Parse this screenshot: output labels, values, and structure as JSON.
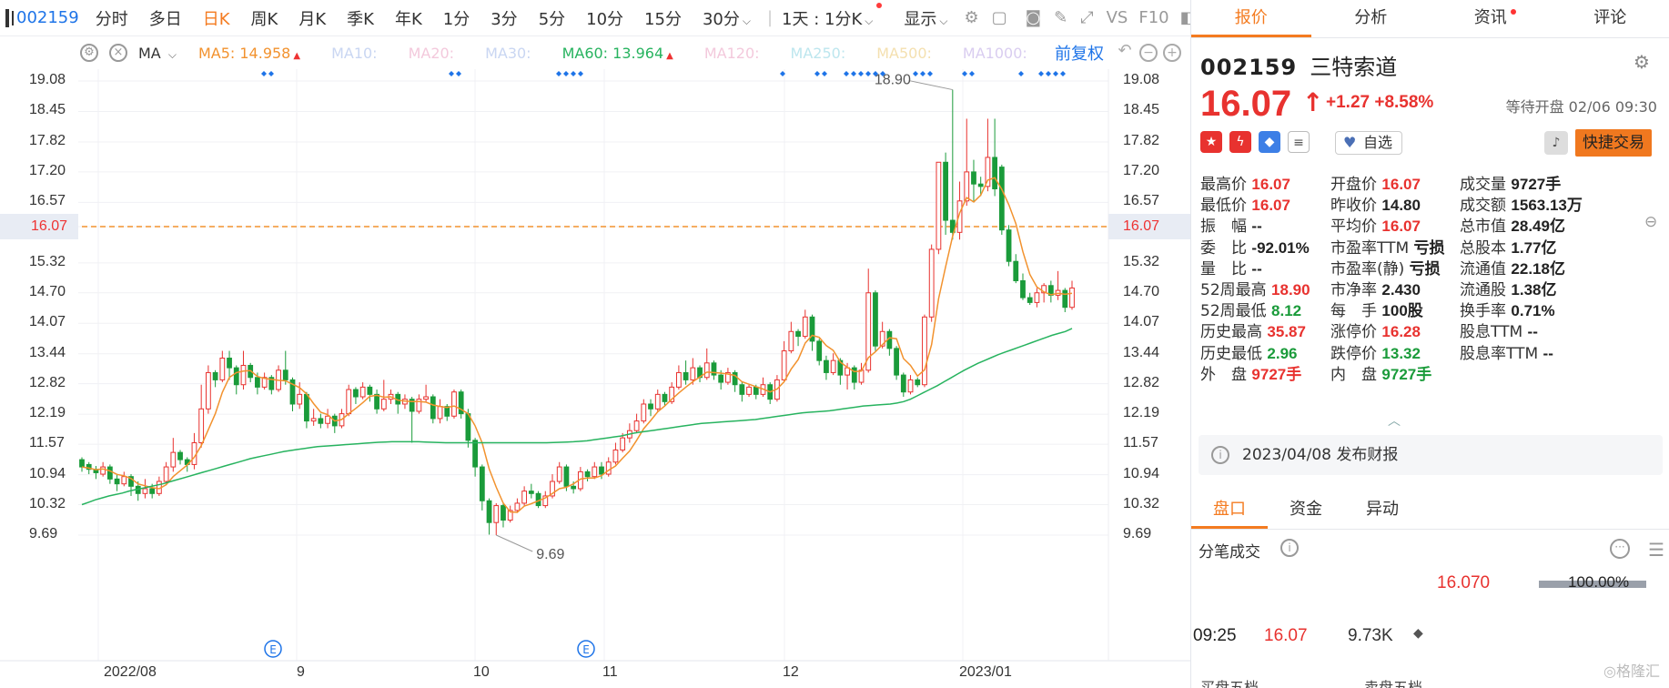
{
  "toolbar": {
    "code": "002159",
    "items": [
      "分时",
      "多日",
      "日K",
      "周K",
      "月K",
      "季K",
      "年K",
      "1分",
      "3分",
      "5分",
      "10分",
      "15分"
    ],
    "active": "日K",
    "dropdown_30": "30分",
    "dropdown_range": "1天 : 1分K",
    "dropdown_display": "显示",
    "vs": "VS",
    "f10": "F10"
  },
  "ma_bar": {
    "selector": "MA",
    "ma5_label": "MA5:",
    "ma5_value": "14.958",
    "ma10": "MA10:",
    "ma20": "MA20:",
    "ma30": "MA30:",
    "ma60_label": "MA60:",
    "ma60_value": "13.964",
    "ma120": "MA120:",
    "ma250": "MA250:",
    "ma500": "MA500:",
    "ma1000": "MA1000:",
    "adjust": "前复权",
    "colors": {
      "ma5": "#f2922e",
      "ma60": "#27b35f",
      "faint": "#c9d6f2"
    }
  },
  "chart_data": {
    "type": "candlestick",
    "y_ticks": [
      "19.08",
      "18.45",
      "17.82",
      "17.20",
      "16.57",
      "16.07",
      "15.32",
      "14.70",
      "14.07",
      "13.44",
      "12.82",
      "12.19",
      "11.57",
      "10.94",
      "10.32",
      "9.69"
    ],
    "current_price": "16.07",
    "x_labels": [
      "2022/08",
      "9",
      "10",
      "11",
      "12",
      "2023/01"
    ],
    "annotation_high": "18.90",
    "annotation_low": "9.69",
    "event_marker": "E",
    "candles": [
      [
        11.25,
        11.1,
        11.3,
        11.0
      ],
      [
        11.15,
        11.05,
        11.2,
        10.95
      ],
      [
        11.05,
        10.98,
        11.12,
        10.85
      ],
      [
        10.95,
        11.1,
        11.2,
        10.9
      ],
      [
        11.1,
        10.85,
        11.15,
        10.75
      ],
      [
        10.85,
        10.75,
        10.95,
        10.6
      ],
      [
        10.75,
        10.9,
        11.0,
        10.7
      ],
      [
        10.9,
        10.7,
        10.95,
        10.5
      ],
      [
        10.7,
        10.55,
        10.8,
        10.4
      ],
      [
        10.55,
        10.65,
        10.85,
        10.45
      ],
      [
        10.65,
        10.55,
        10.75,
        10.45
      ],
      [
        10.55,
        10.8,
        10.9,
        10.5
      ],
      [
        10.8,
        11.1,
        11.2,
        10.75
      ],
      [
        11.1,
        11.4,
        11.7,
        11.0
      ],
      [
        11.4,
        11.25,
        11.45,
        11.15
      ],
      [
        11.25,
        11.15,
        11.3,
        11.0
      ],
      [
        11.15,
        11.6,
        11.8,
        11.05
      ],
      [
        11.6,
        12.3,
        12.8,
        11.5
      ],
      [
        12.3,
        13.05,
        13.2,
        12.2
      ],
      [
        13.05,
        12.9,
        13.1,
        12.75
      ],
      [
        12.9,
        13.35,
        13.5,
        12.85
      ],
      [
        13.35,
        13.15,
        13.5,
        12.9
      ],
      [
        13.15,
        12.8,
        13.2,
        12.6
      ],
      [
        12.8,
        13.2,
        13.5,
        12.7
      ],
      [
        13.2,
        12.95,
        13.25,
        12.85
      ],
      [
        12.95,
        12.75,
        13.05,
        12.6
      ],
      [
        12.75,
        12.95,
        13.05,
        12.7
      ],
      [
        12.95,
        12.7,
        13.0,
        12.6
      ],
      [
        12.7,
        13.1,
        13.2,
        12.65
      ],
      [
        13.1,
        12.9,
        13.5,
        12.8
      ],
      [
        12.9,
        12.4,
        12.95,
        12.25
      ],
      [
        12.4,
        12.6,
        12.85,
        12.3
      ],
      [
        12.6,
        12.05,
        12.65,
        11.9
      ],
      [
        12.05,
        12.1,
        12.3,
        11.95
      ],
      [
        12.1,
        12.0,
        12.2,
        11.9
      ],
      [
        12.0,
        12.15,
        12.3,
        11.9
      ],
      [
        12.15,
        11.95,
        12.2,
        11.8
      ],
      [
        11.95,
        12.2,
        12.3,
        11.9
      ],
      [
        12.2,
        12.7,
        12.8,
        12.15
      ],
      [
        12.7,
        12.55,
        12.75,
        12.4
      ],
      [
        12.55,
        12.75,
        12.85,
        12.5
      ],
      [
        12.75,
        12.6,
        12.8,
        12.45
      ],
      [
        12.6,
        12.3,
        12.7,
        12.2
      ],
      [
        12.3,
        12.5,
        12.9,
        12.25
      ],
      [
        12.5,
        12.6,
        12.7,
        12.4
      ],
      [
        12.6,
        12.4,
        12.65,
        12.2
      ],
      [
        12.4,
        12.5,
        12.6,
        12.3
      ],
      [
        12.5,
        12.25,
        12.55,
        11.6
      ],
      [
        12.25,
        12.5,
        12.6,
        12.2
      ],
      [
        12.5,
        12.55,
        12.8,
        12.45
      ],
      [
        12.55,
        12.1,
        12.6,
        12.0
      ],
      [
        12.1,
        12.35,
        12.5,
        12.0
      ],
      [
        12.35,
        12.15,
        12.4,
        12.05
      ],
      [
        12.15,
        12.65,
        12.7,
        12.1
      ],
      [
        12.65,
        12.2,
        12.7,
        12.1
      ],
      [
        12.2,
        11.65,
        12.3,
        11.5
      ],
      [
        11.65,
        11.1,
        11.7,
        10.9
      ],
      [
        11.1,
        10.4,
        11.15,
        10.2
      ],
      [
        10.4,
        9.95,
        10.45,
        9.7
      ],
      [
        9.95,
        10.3,
        10.35,
        9.69
      ],
      [
        10.3,
        10.0,
        10.35,
        9.85
      ],
      [
        10.0,
        10.2,
        10.3,
        9.95
      ],
      [
        10.2,
        10.35,
        10.45,
        10.15
      ],
      [
        10.35,
        10.6,
        10.7,
        10.3
      ],
      [
        10.6,
        10.55,
        10.75,
        10.45
      ],
      [
        10.55,
        10.3,
        10.6,
        10.25
      ],
      [
        10.3,
        10.5,
        10.6,
        10.25
      ],
      [
        10.5,
        10.8,
        10.95,
        10.45
      ],
      [
        10.8,
        11.1,
        11.2,
        10.75
      ],
      [
        11.1,
        10.7,
        11.15,
        10.6
      ],
      [
        10.7,
        10.65,
        10.8,
        10.55
      ],
      [
        10.65,
        11.0,
        11.1,
        10.6
      ],
      [
        11.0,
        10.9,
        11.05,
        10.8
      ],
      [
        10.9,
        11.1,
        11.2,
        10.85
      ],
      [
        11.1,
        10.95,
        11.2,
        10.85
      ],
      [
        10.95,
        11.2,
        11.3,
        10.9
      ],
      [
        11.2,
        11.45,
        11.6,
        11.15
      ],
      [
        11.45,
        11.7,
        11.8,
        11.4
      ],
      [
        11.7,
        11.85,
        12.0,
        11.6
      ],
      [
        11.85,
        12.05,
        12.2,
        11.8
      ],
      [
        12.05,
        12.4,
        12.5,
        12.0
      ],
      [
        12.4,
        12.3,
        12.5,
        12.15
      ],
      [
        12.3,
        12.6,
        12.7,
        12.25
      ],
      [
        12.6,
        12.45,
        12.65,
        12.35
      ],
      [
        12.45,
        12.75,
        12.85,
        12.4
      ],
      [
        12.75,
        13.05,
        13.2,
        12.7
      ],
      [
        13.05,
        12.9,
        13.3,
        12.8
      ],
      [
        12.9,
        13.15,
        13.35,
        12.8
      ],
      [
        13.15,
        12.95,
        13.2,
        12.85
      ],
      [
        12.95,
        13.25,
        13.55,
        12.9
      ],
      [
        13.25,
        13.0,
        13.3,
        12.9
      ],
      [
        13.0,
        12.85,
        13.1,
        12.7
      ],
      [
        12.85,
        13.05,
        13.15,
        12.8
      ],
      [
        13.05,
        12.8,
        13.1,
        12.65
      ],
      [
        12.8,
        12.6,
        12.85,
        12.45
      ],
      [
        12.6,
        12.75,
        12.8,
        12.55
      ],
      [
        12.75,
        12.6,
        12.8,
        12.5
      ],
      [
        12.6,
        12.8,
        12.95,
        12.55
      ],
      [
        12.8,
        12.5,
        12.85,
        12.4
      ],
      [
        12.5,
        12.9,
        13.0,
        12.45
      ],
      [
        12.9,
        13.5,
        13.7,
        12.85
      ],
      [
        13.5,
        13.9,
        14.1,
        13.45
      ],
      [
        13.9,
        13.8,
        13.95,
        13.6
      ],
      [
        13.8,
        14.2,
        14.35,
        13.75
      ],
      [
        14.2,
        13.7,
        14.25,
        13.5
      ],
      [
        13.7,
        13.3,
        13.75,
        13.2
      ],
      [
        13.3,
        13.05,
        13.4,
        12.9
      ],
      [
        13.05,
        13.3,
        13.45,
        13.0
      ],
      [
        13.3,
        13.0,
        13.35,
        12.8
      ],
      [
        13.0,
        13.15,
        13.25,
        12.7
      ],
      [
        13.15,
        12.85,
        13.2,
        12.7
      ],
      [
        12.85,
        13.1,
        13.25,
        12.8
      ],
      [
        13.1,
        14.7,
        15.2,
        13.05
      ],
      [
        14.7,
        13.6,
        14.75,
        13.5
      ],
      [
        13.6,
        13.9,
        14.1,
        13.55
      ],
      [
        13.9,
        13.55,
        13.95,
        13.4
      ],
      [
        13.55,
        13.0,
        13.6,
        12.9
      ],
      [
        13.0,
        12.65,
        13.05,
        12.55
      ],
      [
        12.65,
        12.9,
        13.0,
        12.6
      ],
      [
        12.9,
        12.8,
        12.95,
        12.75
      ],
      [
        12.8,
        14.2,
        14.25,
        12.75
      ],
      [
        14.2,
        15.6,
        15.7,
        14.1
      ],
      [
        15.6,
        17.4,
        17.4,
        15.5
      ],
      [
        17.4,
        16.2,
        17.6,
        15.9
      ],
      [
        16.2,
        15.95,
        18.9,
        15.8
      ],
      [
        15.95,
        16.6,
        17.0,
        15.8
      ],
      [
        16.6,
        17.2,
        18.3,
        16.5
      ],
      [
        17.2,
        16.95,
        17.45,
        16.6
      ],
      [
        16.95,
        16.9,
        17.1,
        16.7
      ],
      [
        16.9,
        17.5,
        18.3,
        16.8
      ],
      [
        17.5,
        16.85,
        18.3,
        16.7
      ],
      [
        17.3,
        16.0,
        17.35,
        15.9
      ],
      [
        16.0,
        15.35,
        16.1,
        15.25
      ],
      [
        15.35,
        14.95,
        15.5,
        14.9
      ],
      [
        14.95,
        14.6,
        15.1,
        14.55
      ],
      [
        14.6,
        14.5,
        14.7,
        14.45
      ],
      [
        14.5,
        14.7,
        14.8,
        14.4
      ],
      [
        14.7,
        14.85,
        14.9,
        14.5
      ],
      [
        14.85,
        14.65,
        14.95,
        14.5
      ],
      [
        14.65,
        14.75,
        15.15,
        14.55
      ],
      [
        14.75,
        14.4,
        14.8,
        14.3
      ],
      [
        14.4,
        14.8,
        14.95,
        14.35
      ]
    ],
    "ma60_series": [
      10.32,
      10.37,
      10.42,
      10.46,
      10.5,
      10.53,
      10.56,
      10.6,
      10.63,
      10.66,
      10.69,
      10.72,
      10.75,
      10.79,
      10.83,
      10.87,
      10.91,
      10.95,
      10.99,
      11.03,
      11.07,
      11.11,
      11.15,
      11.19,
      11.23,
      11.27,
      11.3,
      11.33,
      11.36,
      11.39,
      11.42,
      11.44,
      11.46,
      11.48,
      11.5,
      11.52,
      11.53,
      11.54,
      11.55,
      11.56,
      11.57,
      11.58,
      11.59,
      11.6,
      11.61,
      11.615,
      11.62,
      11.62,
      11.62,
      11.62,
      11.62,
      11.615,
      11.61,
      11.605,
      11.6,
      11.6,
      11.6,
      11.6,
      11.6,
      11.6,
      11.6,
      11.6,
      11.6,
      11.6,
      11.6,
      11.6,
      11.6,
      11.6,
      11.6,
      11.6,
      11.605,
      11.61,
      11.615,
      11.62,
      11.63,
      11.64,
      11.66,
      11.68,
      11.7,
      11.72,
      11.74,
      11.77,
      11.8,
      11.82,
      11.84,
      11.86,
      11.88,
      11.9,
      11.92,
      11.94,
      11.96,
      11.98,
      12.0,
      12.01,
      12.02,
      12.03,
      12.04,
      12.05,
      12.06,
      12.07,
      12.08,
      12.1,
      12.12,
      12.14,
      12.16,
      12.18,
      12.2,
      12.22,
      12.23,
      12.24,
      12.25,
      12.26,
      12.28,
      12.3,
      12.32,
      12.34,
      12.36,
      12.37,
      12.38,
      12.39,
      12.4,
      12.42,
      12.45,
      12.5,
      12.57,
      12.64,
      12.71,
      12.78,
      12.86,
      12.94,
      13.02,
      13.1,
      13.17,
      13.24,
      13.3,
      13.36,
      13.42,
      13.47,
      13.52,
      13.57,
      13.62,
      13.67,
      13.72,
      13.77,
      13.82,
      13.86,
      13.9,
      13.964
    ]
  },
  "right": {
    "tabs": [
      "报价",
      "分析",
      "资讯",
      "评论"
    ],
    "active_tab": "报价",
    "code": "002159",
    "name": "三特索道",
    "price": "16.07",
    "arrow": "↑",
    "change": "+1.27",
    "change_pct": "+8.58%",
    "status": "等待开盘 02/06 09:30",
    "watch": "自选",
    "trade": "快捷交易",
    "stats": [
      [
        {
          "k": "最高价",
          "v": "16.07",
          "c": "red"
        },
        {
          "k": "开盘价",
          "v": "16.07",
          "c": "red"
        },
        {
          "k": "成交量",
          "v": "9727手",
          "c": "dark"
        }
      ],
      [
        {
          "k": "最低价",
          "v": "16.07",
          "c": "red"
        },
        {
          "k": "昨收价",
          "v": "14.80",
          "c": "dark"
        },
        {
          "k": "成交额",
          "v": "1563.13万",
          "c": "dark"
        }
      ],
      [
        {
          "k": "振　幅",
          "v": "--",
          "c": "dark"
        },
        {
          "k": "平均价",
          "v": "16.07",
          "c": "red"
        },
        {
          "k": "总市值",
          "v": "28.49亿",
          "c": "dark"
        }
      ],
      [
        {
          "k": "委　比",
          "v": "-92.01%",
          "c": "dark"
        },
        {
          "k": "市盈率TTM",
          "v": "亏损",
          "c": "dark"
        },
        {
          "k": "总股本",
          "v": "1.77亿",
          "c": "dark"
        }
      ],
      [
        {
          "k": "量　比",
          "v": "--",
          "c": "dark"
        },
        {
          "k": "市盈率(静)",
          "v": "亏损",
          "c": "dark"
        },
        {
          "k": "流通值",
          "v": "22.18亿",
          "c": "dark"
        }
      ],
      [
        {
          "k": "52周最高",
          "v": "18.90",
          "c": "red"
        },
        {
          "k": "市净率",
          "v": "2.430",
          "c": "dark"
        },
        {
          "k": "流通股",
          "v": "1.38亿",
          "c": "dark"
        }
      ],
      [
        {
          "k": "52周最低",
          "v": "8.12",
          "c": "green"
        },
        {
          "k": "每　手",
          "v": "100股",
          "c": "dark"
        },
        {
          "k": "换手率",
          "v": "0.71%",
          "c": "dark"
        }
      ],
      [
        {
          "k": "历史最高",
          "v": "35.87",
          "c": "red"
        },
        {
          "k": "涨停价",
          "v": "16.28",
          "c": "red"
        },
        {
          "k": "股息TTM",
          "v": "--",
          "c": "dark"
        }
      ],
      [
        {
          "k": "历史最低",
          "v": "2.96",
          "c": "green"
        },
        {
          "k": "跌停价",
          "v": "13.32",
          "c": "green"
        },
        {
          "k": "股息率TTM",
          "v": "--",
          "c": "dark"
        }
      ],
      [
        {
          "k": "外　盘",
          "v": "9727手",
          "c": "red"
        },
        {
          "k": "内　盘",
          "v": "9727手",
          "c": "green"
        }
      ]
    ],
    "notice": "2023/04/08 发布财报",
    "subtabs": [
      "盘口",
      "资金",
      "异动"
    ],
    "active_subtab": "盘口",
    "ticks_title": "分笔成交",
    "tick_price": "16.070",
    "tick_pct": "100.00%",
    "tick_fill": 1.0,
    "tick_row": {
      "time": "09:25",
      "price": "16.07",
      "vol": "9.73K"
    },
    "cut_left": "买盘五档",
    "cut_right": "卖盘五档",
    "watermark": "格隆汇"
  }
}
